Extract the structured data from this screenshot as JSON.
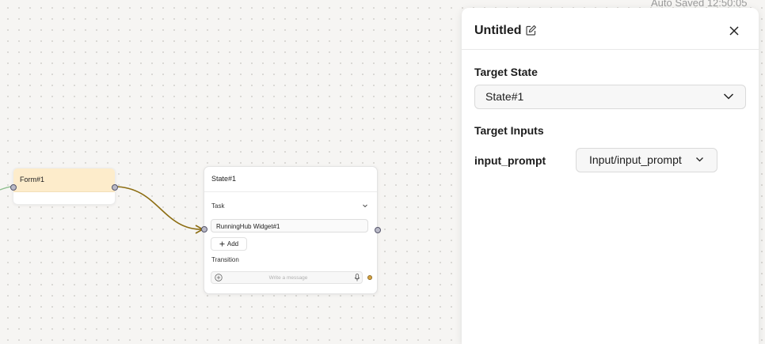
{
  "autosave_text": "Auto Saved 12:50:05",
  "canvas": {
    "form_node": {
      "title": "Form#1"
    },
    "state_node": {
      "title": "State#1",
      "task_label": "Task",
      "widget_chip": "RunningHub Widget#1",
      "add_label": "Add",
      "transition_label": "Transition",
      "message_placeholder": "Write a message"
    },
    "edge_color": "#8c6d12"
  },
  "panel": {
    "title": "Untitled",
    "target_state_label": "Target State",
    "target_state_value": "State#1",
    "target_inputs_label": "Target Inputs",
    "inputs": [
      {
        "name": "input_prompt",
        "value": "Input/input_prompt"
      }
    ]
  },
  "icons": [
    "edit-icon",
    "close-icon",
    "chevron-down-icon",
    "plus-icon",
    "mic-icon",
    "plus-circle-icon"
  ]
}
